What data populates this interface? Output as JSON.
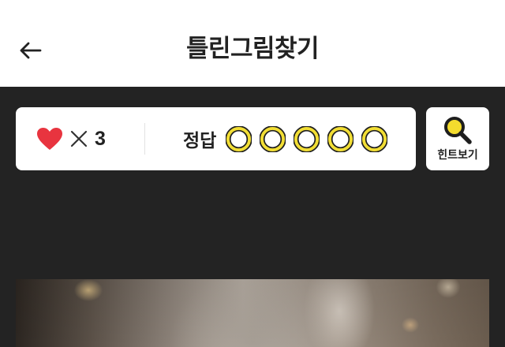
{
  "header": {
    "title": "틀린그림찾기",
    "back_icon": "arrow-left-icon"
  },
  "status": {
    "lives_icon": "heart-icon",
    "lives_multiplier_icon": "times-icon",
    "lives_count": "3",
    "answer_label": "정답",
    "answers_found": 0,
    "answers_total": 5,
    "answer_slot_icon": "circle-outline-icon"
  },
  "hint": {
    "label": "힌트보기",
    "icon": "search-icon"
  },
  "colors": {
    "header_bg": "#ffffff",
    "screen_bg": "#232323",
    "heart": "#e8343f",
    "answer_ring": "#f2de35",
    "answer_ring_outline": "#1e1e1e",
    "magnifier_lens": "#f4dc2e",
    "text": "#222222"
  }
}
